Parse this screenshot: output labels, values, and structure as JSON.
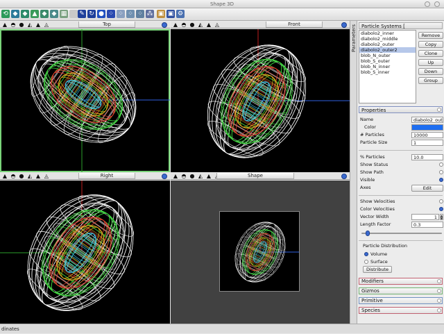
{
  "window": {
    "title": "Shape 3D"
  },
  "toolbar": {
    "icons": [
      "reset-view-icon",
      "cube-icon",
      "cube-shaded-icon",
      "pyramid-icon",
      "flat-shape-icon",
      "flat-shape-2-icon",
      "grid-icon",
      "shapes-icon",
      "edit-icon",
      "rotate-icon",
      "sphere-icon",
      "particles-icon",
      "particles-2-icon",
      "particles-3-icon",
      "particles-4-icon",
      "nodes-icon",
      "layout-icon",
      "layout-2-icon",
      "gear-icon"
    ]
  },
  "viewports": [
    {
      "label": "Top"
    },
    {
      "label": "Front"
    },
    {
      "label": "Right"
    },
    {
      "label": "Shape"
    }
  ],
  "side_tab": {
    "label": "Parameters"
  },
  "particle_systems": {
    "header": "Particle Systems [ diabolo2_outer2 ]",
    "items": [
      "diabolo2_inner",
      "diabolo2_middle",
      "diabolo2_outer",
      "diabolo2_outer2",
      "blob_N_outer",
      "blob_S_outer",
      "blob_N_inner",
      "blob_S_inner"
    ],
    "selected_index": 3,
    "buttons": {
      "remove": "Remove",
      "copy": "Copy",
      "clone": "Clone",
      "up": "Up",
      "down": "Down",
      "group": "Group"
    }
  },
  "properties": {
    "header": "Properties",
    "name_label": "Name",
    "name_value": "diabolo2_outer2",
    "color_label": "Color",
    "color_value": "#1e6ef0",
    "num_particles_label": "# Particles",
    "num_particles_value": "10000",
    "particle_size_label": "Particle Size",
    "particle_size_value": "1",
    "pct_particles_label": "% Particles",
    "pct_particles_value": "10.0",
    "show_status_label": "Show Status",
    "show_path_label": "Show Path",
    "visible_label": "Visible",
    "axes_label": "Axes",
    "axes_button": "Edit",
    "show_velocities_label": "Show Velocities",
    "color_velocities_label": "Color Velocities",
    "vector_width_label": "Vector Width",
    "vector_width_value": "1",
    "length_factor_label": "Length Factor",
    "length_factor_value": "0.3",
    "length_factor_slider": 0.05,
    "distribution_label": "Particle Distribution",
    "volume_label": "Volume",
    "surface_label": "Surface",
    "distribute_button": "Distribute"
  },
  "sections": [
    "Modifiers",
    "Gizmos",
    "Primitive",
    "Species"
  ],
  "statusbar": {
    "text": "dinates"
  }
}
